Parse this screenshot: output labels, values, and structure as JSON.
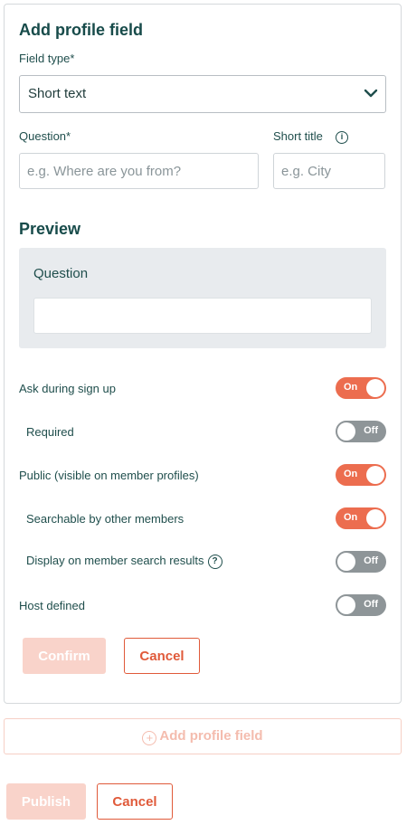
{
  "form": {
    "title": "Add profile field",
    "field_type_label": "Field type*",
    "field_type_value": "Short text",
    "question_label": "Question*",
    "question_placeholder": "e.g. Where are you from?",
    "short_title_label": "Short title",
    "short_title_placeholder": "e.g. City",
    "info_icon": "i"
  },
  "preview": {
    "heading": "Preview",
    "question": "Question"
  },
  "settings": [
    {
      "label": "Ask during sign up",
      "state": "On"
    },
    {
      "label": "Required",
      "state": "Off"
    },
    {
      "label": "Public (visible on member profiles)",
      "state": "On"
    },
    {
      "label": "Searchable by other members",
      "state": "On"
    },
    {
      "label": "Display on member search results",
      "state": "Off"
    },
    {
      "label": "Host defined",
      "state": "Off"
    }
  ],
  "help_icon": "?",
  "actions": {
    "confirm": "Confirm",
    "cancel": "Cancel"
  },
  "add_profile_field": {
    "icon": "+",
    "label": "Add profile field"
  },
  "footer": {
    "publish": "Publish",
    "cancel": "Cancel"
  },
  "colors": {
    "accent": "#ec6d4f",
    "heading": "#174b4a",
    "toggle_off": "#8e9598"
  }
}
